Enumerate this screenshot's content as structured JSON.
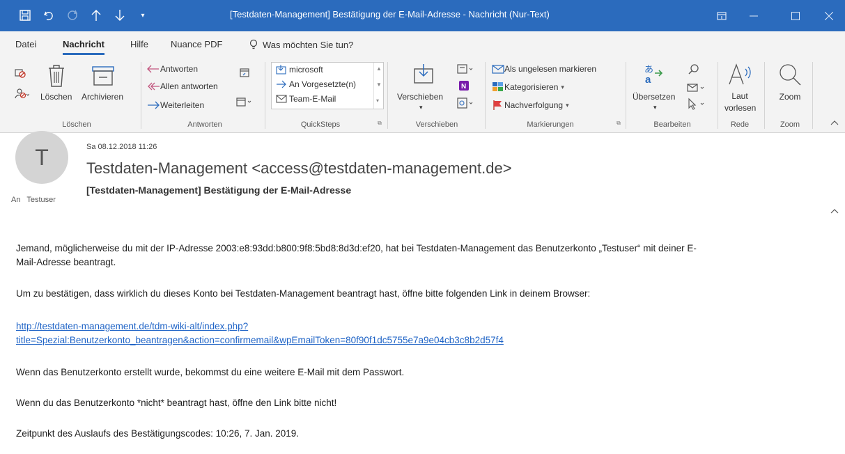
{
  "titlebar": {
    "title": "[Testdaten-Management] Bestätigung der E-Mail-Adresse  -  Nachricht (Nur-Text)",
    "quick_access": [
      "save-icon",
      "undo-icon",
      "redo-icon",
      "up-arrow-icon",
      "down-arrow-icon",
      "customize-icon"
    ],
    "window_buttons": [
      "ribbon-display-icon",
      "minimize-icon",
      "maximize-icon",
      "close-icon"
    ]
  },
  "menu": {
    "tabs": [
      "Datei",
      "Nachricht",
      "Hilfe",
      "Nuance PDF"
    ],
    "active": "Nachricht",
    "tell_me": "Was möchten Sie tun?"
  },
  "ribbon": {
    "delete_group": {
      "label": "Löschen",
      "delete": "Löschen",
      "archive": "Archivieren"
    },
    "respond_group": {
      "label": "Antworten",
      "reply": "Antworten",
      "reply_all": "Allen antworten",
      "forward": "Weiterleiten"
    },
    "quicksteps_group": {
      "label": "QuickSteps",
      "items": [
        "microsoft",
        "An Vorgesetzte(n)",
        "Team-E-Mail"
      ]
    },
    "move_group": {
      "label": "Verschieben",
      "move": "Verschieben"
    },
    "tags_group": {
      "label": "Markierungen",
      "unread": "Als ungelesen markieren",
      "categorize": "Kategorisieren",
      "followup": "Nachverfolgung"
    },
    "edit_group": {
      "label": "Bearbeiten",
      "translate": "Übersetzen"
    },
    "speech_group": {
      "label": "Rede",
      "read_aloud_1": "Laut",
      "read_aloud_2": "vorlesen"
    },
    "zoom_group": {
      "label": "Zoom",
      "zoom": "Zoom"
    }
  },
  "message": {
    "date": "Sa 08.12.2018 11:26",
    "avatar_initial": "T",
    "sender": "Testdaten-Management <access@testdaten-management.de>",
    "subject": "[Testdaten-Management] Bestätigung der E-Mail-Adresse",
    "to_label": "An",
    "to": "Testuser",
    "body": {
      "p1_line1": "Jemand, möglicherweise du mit der IP-Adresse 2003:e8:93dd:b800:9f8:5bd8:8d3d:ef20, hat bei Testdaten-Management das Benutzerkonto „Testuser“ mit deiner E-",
      "p1_line2": "Mail-Adresse beantragt.",
      "p2": "Um zu bestätigen, dass wirklich du dieses Konto bei Testdaten-Management beantragt hast, öffne bitte folgenden Link in deinem Browser:",
      "link_line1": "http://testdaten-management.de/tdm-wiki-alt/index.php?",
      "link_line2": "title=Spezial:Benutzerkonto_beantragen&action=confirmemail&wpEmailToken=80f90f1dc5755e7a9e04cb3c8b2d57f4",
      "p3": "Wenn das Benutzerkonto erstellt wurde, bekommst du eine weitere E-Mail mit dem Passwort.",
      "p4": "Wenn du das Benutzerkonto *nicht* beantragt hast, öffne den Link bitte nicht!",
      "p5": "Zeitpunkt des Auslaufs des Bestätigungscodes: 10:26, 7. Jan. 2019."
    }
  },
  "colors": {
    "accent": "#2b6bbd",
    "link": "#1e63c6",
    "ribbon_bg": "#f3f3f3"
  }
}
